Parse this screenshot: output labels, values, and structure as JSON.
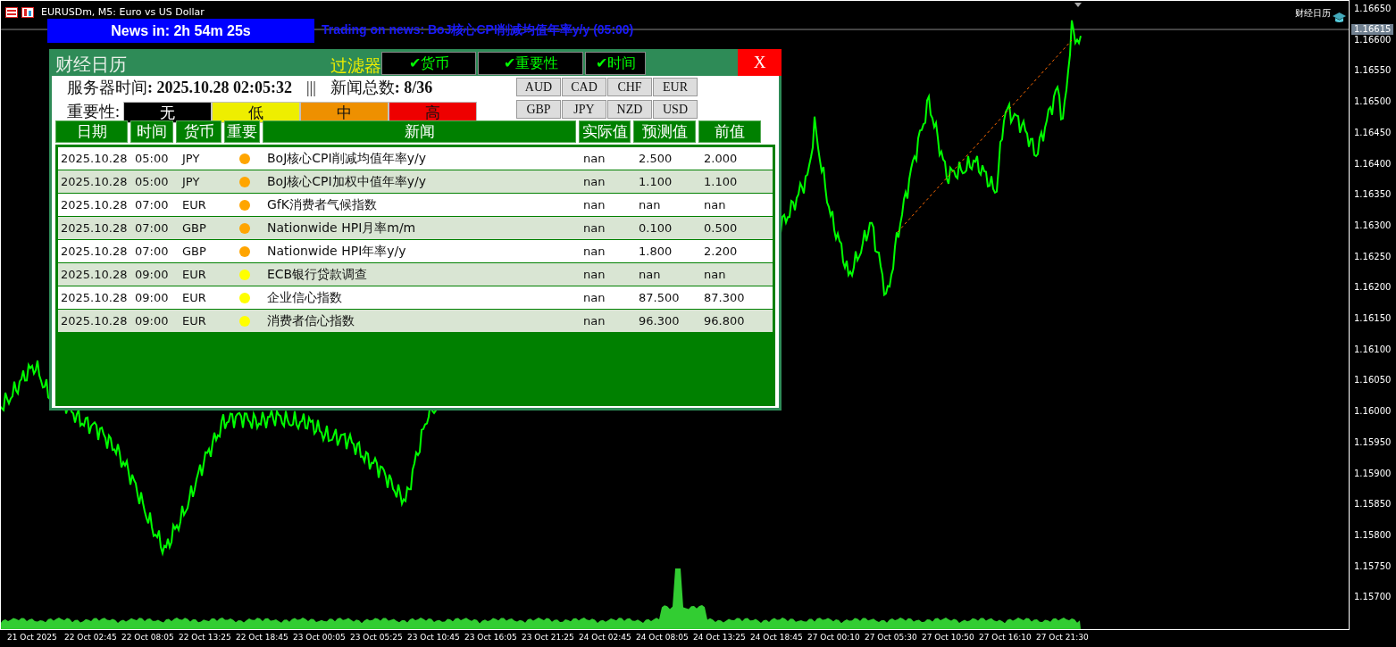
{
  "window": {
    "title": "EURUSDm, M5:  Euro vs US Dollar"
  },
  "countdown": {
    "label": "News in: 2h 54m 25s"
  },
  "next_news": "Trading on news: BoJ核心CPI削减均值年率y/y (05:00)",
  "indicator_label": "财经日历",
  "price_axis": {
    "labels": [
      "1.16650",
      "1.16600",
      "1.16550",
      "1.16500",
      "1.16450",
      "1.16400",
      "1.16350",
      "1.16300",
      "1.16250",
      "1.16200",
      "1.16150",
      "1.16100",
      "1.16050",
      "1.16000",
      "1.15950",
      "1.15900",
      "1.15850",
      "1.15800",
      "1.15750",
      "1.15700"
    ],
    "current": "1.16615"
  },
  "time_axis": {
    "labels": [
      "21 Oct 2025",
      "22 Oct 02:45",
      "22 Oct 08:05",
      "22 Oct 13:25",
      "22 Oct 18:45",
      "23 Oct 00:05",
      "23 Oct 05:25",
      "23 Oct 10:45",
      "23 Oct 16:05",
      "23 Oct 21:25",
      "24 Oct 02:45",
      "24 Oct 08:05",
      "24 Oct 13:25",
      "24 Oct 18:45",
      "27 Oct 00:10",
      "27 Oct 05:30",
      "27 Oct 10:50",
      "27 Oct 16:10",
      "27 Oct 21:30"
    ]
  },
  "panel": {
    "title": "财经日历",
    "filter_label": "过滤器",
    "filters": [
      {
        "label": "✔货币",
        "checked": true
      },
      {
        "label": "✔重要性",
        "checked": true
      },
      {
        "label": "✔时间",
        "checked": true
      }
    ],
    "close": "X",
    "server_time": "服务器时间**: 2025.10.28 02:05:32**",
    "separator": "|||",
    "total": "新闻总数**: 8/36**",
    "importance_label": "重要性:",
    "importance_levels": [
      {
        "label": "无",
        "color": "#000000"
      },
      {
        "label": "低",
        "color": "#eeee00"
      },
      {
        "label": "中",
        "color": "#ee9000"
      },
      {
        "label": "高",
        "color": "#ee0000"
      }
    ],
    "currencies": [
      "AUD",
      "CAD",
      "CHF",
      "EUR",
      "GBP",
      "JPY",
      "NZD",
      "USD"
    ],
    "columns": [
      "日期",
      "时间",
      "货币",
      "重要",
      "新闻",
      "实际值",
      "预测值",
      "前值"
    ],
    "rows": [
      {
        "date": "2025.10.28",
        "time": "05:00",
        "currency": "JPY",
        "color": "#ffa500",
        "news": "BoJ核心CPI削减均值年率y/y",
        "actual": "nan",
        "forecast": "2.500",
        "previous": "2.000"
      },
      {
        "date": "2025.10.28",
        "time": "05:00",
        "currency": "JPY",
        "color": "#ffa500",
        "news": "BoJ核心CPI加权中值年率y/y",
        "actual": "nan",
        "forecast": "1.100",
        "previous": "1.100"
      },
      {
        "date": "2025.10.28",
        "time": "07:00",
        "currency": "EUR",
        "color": "#ffa500",
        "news": "GfK消费者气候指数",
        "actual": "nan",
        "forecast": "nan",
        "previous": "nan"
      },
      {
        "date": "2025.10.28",
        "time": "07:00",
        "currency": "GBP",
        "color": "#ffa500",
        "news": "Nationwide HPI月率m/m",
        "actual": "nan",
        "forecast": "0.100",
        "previous": "0.500"
      },
      {
        "date": "2025.10.28",
        "time": "07:00",
        "currency": "GBP",
        "color": "#ffa500",
        "news": "Nationwide HPI年率y/y",
        "actual": "nan",
        "forecast": "1.800",
        "previous": "2.200"
      },
      {
        "date": "2025.10.28",
        "time": "09:00",
        "currency": "EUR",
        "color": "#ffff00",
        "news": "ECB银行贷款调查",
        "actual": "nan",
        "forecast": "nan",
        "previous": "nan"
      },
      {
        "date": "2025.10.28",
        "time": "09:00",
        "currency": "EUR",
        "color": "#ffff00",
        "news": "企业信心指数",
        "actual": "nan",
        "forecast": "87.500",
        "previous": "87.300"
      },
      {
        "date": "2025.10.28",
        "time": "09:00",
        "currency": "EUR",
        "color": "#ffff00",
        "news": "消费者信心指数",
        "actual": "nan",
        "forecast": "96.300",
        "previous": "96.800"
      }
    ]
  }
}
